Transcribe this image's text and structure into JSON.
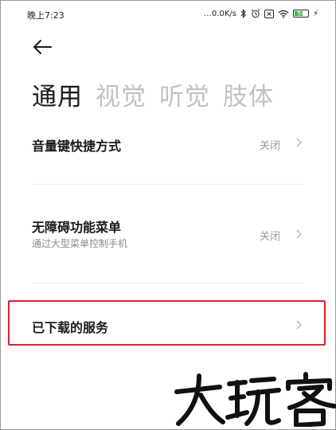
{
  "status_bar": {
    "time": "晚上7:23",
    "net_speed": "…0.0K/s",
    "icons": [
      "bluetooth-icon",
      "alarm-icon",
      "sim-icon",
      "wifi-icon",
      "battery-icon",
      "charging-icon"
    ],
    "battery_level": "64",
    "battery_fraction": 0.64,
    "battery_color": "#3cb44b"
  },
  "header": {
    "back_icon": "arrow-left-icon",
    "tabs": [
      {
        "label": "通用",
        "active": true
      },
      {
        "label": "视觉",
        "active": false
      },
      {
        "label": "听觉",
        "active": false
      },
      {
        "label": "肢体",
        "active": false
      }
    ]
  },
  "settings": [
    {
      "title": "音量键快捷方式",
      "subtitle": "",
      "value": "关闭"
    },
    {
      "title": "无障碍功能菜单",
      "subtitle": "通过大型菜单控制手机",
      "value": "关闭"
    },
    {
      "title": "已下载的服务",
      "subtitle": "",
      "value": ""
    }
  ],
  "highlight_color": "#d6242b",
  "watermark": {
    "logo_text": "大玩客"
  }
}
